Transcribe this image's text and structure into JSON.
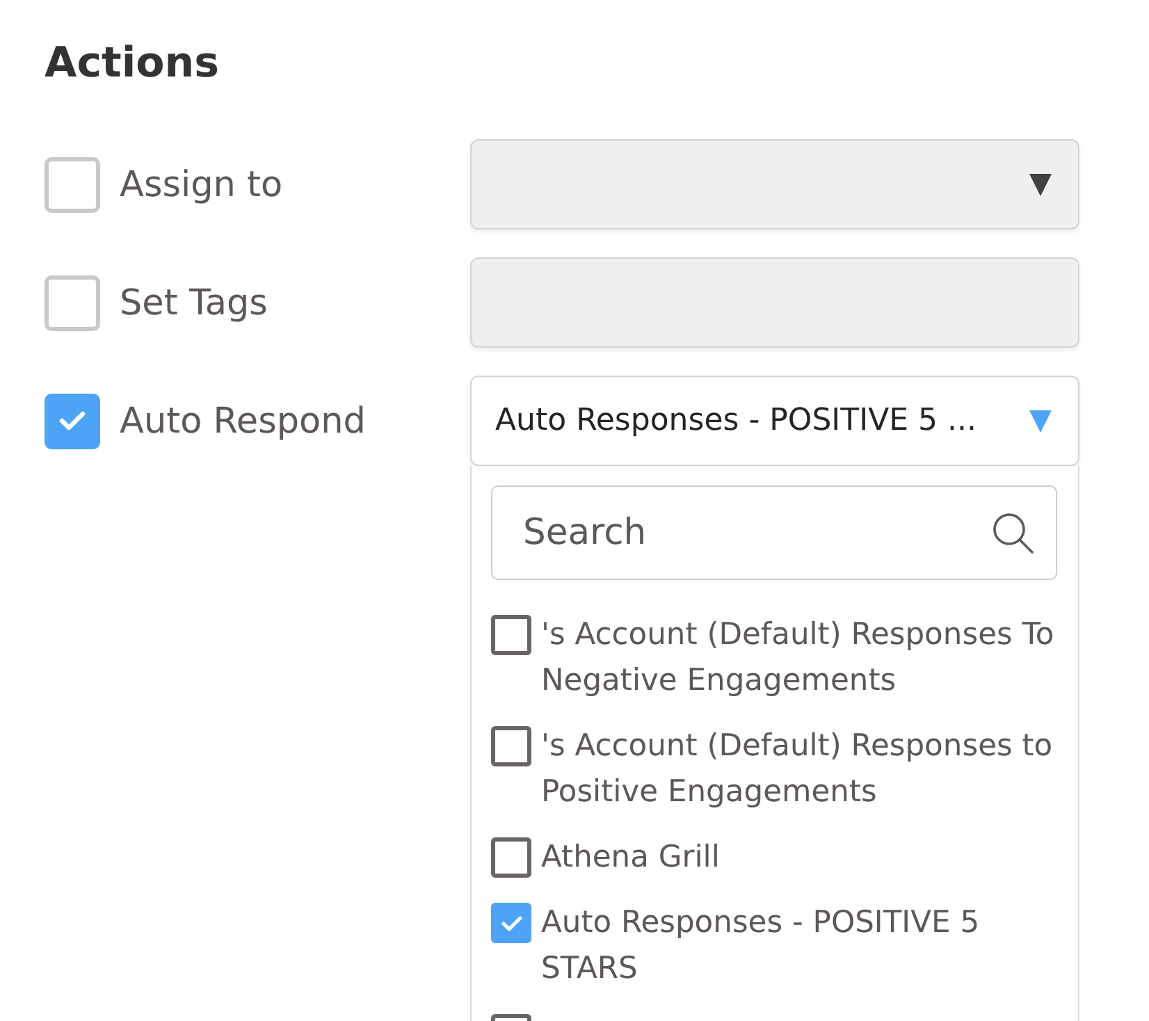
{
  "title": "Actions",
  "actions": [
    {
      "label": "Assign to",
      "checked": false,
      "field": {
        "kind": "select",
        "disabled": true
      }
    },
    {
      "label": "Set Tags",
      "checked": false,
      "field": {
        "kind": "text",
        "disabled": true
      }
    },
    {
      "label": "Auto Respond",
      "checked": true,
      "field": {
        "kind": "select",
        "disabled": false,
        "value": "Auto Responses - POSITIVE 5 ...",
        "open": true,
        "menu": {
          "search": {
            "placeholder": "Search"
          },
          "options": [
            {
              "label": "'s Account (Default) Responses To Negative Engagements",
              "checked": false
            },
            {
              "label": "'s Account (Default) Responses to Positive Engagements",
              "checked": false
            },
            {
              "label": "Athena Grill",
              "checked": false
            },
            {
              "label": "Auto Responses - POSITIVE 5 STARS",
              "checked": true
            },
            {
              "checked": false
            }
          ]
        }
      }
    }
  ]
}
